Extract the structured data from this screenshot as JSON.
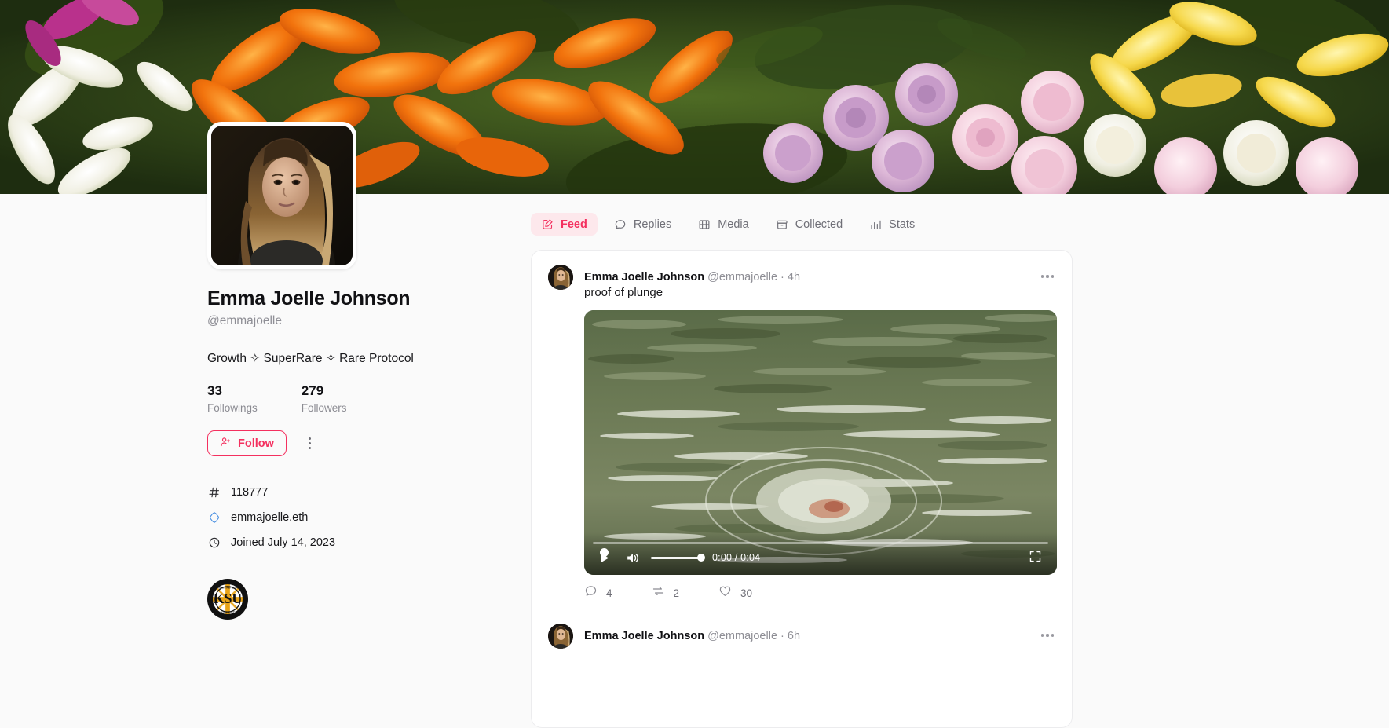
{
  "theme": {
    "accent": "#f4305f",
    "accent_soft_bg": "#fde8ec",
    "page_bg": "#fafafa",
    "card_bg": "#ffffff",
    "text": "#111114",
    "muted": "#8e8e95",
    "ens_blue": "#4a90e2"
  },
  "banner": {
    "name": "profile-banner",
    "alt": "lilies and roses flower arrangement"
  },
  "profile": {
    "avatar_alt": "portrait of woman with long hair on dark background",
    "display_name": "Emma Joelle Johnson",
    "handle": "@emmajoelle",
    "bio": "Growth ✧ SuperRare ✧ Rare Protocol",
    "stats": [
      {
        "value": "33",
        "label": "Followings"
      },
      {
        "value": "279",
        "label": "Followers"
      }
    ],
    "follow_label": "Follow",
    "follow_icon": "user-plus-icon",
    "more_icon": "kebab-vertical-icon",
    "meta": [
      {
        "icon": "hash-icon",
        "text": "118777"
      },
      {
        "icon": "ens-diamond-icon",
        "text": "emmajoelle.eth"
      },
      {
        "icon": "clock-icon",
        "text": "Joined July 14, 2023"
      }
    ],
    "badge": {
      "icon": "ksu-badge-icon",
      "label": "KSU"
    }
  },
  "tabs": [
    {
      "label": "Feed",
      "icon": "pencil-square-icon",
      "active": true
    },
    {
      "label": "Replies",
      "icon": "comment-icon",
      "active": false
    },
    {
      "label": "Media",
      "icon": "film-icon",
      "active": false
    },
    {
      "label": "Collected",
      "icon": "archive-box-icon",
      "active": false
    },
    {
      "label": "Stats",
      "icon": "bar-chart-icon",
      "active": false
    }
  ],
  "posts": [
    {
      "author_name": "Emma Joelle Johnson",
      "author_handle": "@emmajoelle",
      "separator": "·",
      "time": "4h",
      "text": "proof of plunge",
      "more_icon": "kebab-horizontal-icon",
      "media": {
        "type": "video",
        "alt": "swimmer in green river water",
        "play_icon": "play-icon",
        "volume_icon": "volume-high-icon",
        "fullscreen_icon": "fullscreen-icon",
        "time_display": "0:00 / 0:04",
        "current_time": "0:00",
        "duration": "0:04",
        "progress_percent": 2,
        "volume_percent": 100
      },
      "engagement": [
        {
          "icon": "comment-icon",
          "count": "4"
        },
        {
          "icon": "recast-icon",
          "count": "2"
        },
        {
          "icon": "heart-icon",
          "count": "30"
        }
      ]
    },
    {
      "author_name": "Emma Joelle Johnson",
      "author_handle": "@emmajoelle",
      "separator": "·",
      "time": "6h",
      "more_icon": "kebab-horizontal-icon"
    }
  ]
}
